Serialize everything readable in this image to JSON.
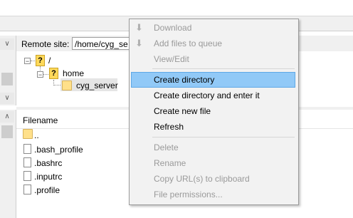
{
  "remote": {
    "label": "Remote site:",
    "path": "/home/cyg_se"
  },
  "tree": {
    "root": "/",
    "home": "home",
    "child": "cyg_server"
  },
  "list": {
    "column_filename": "Filename",
    "files": [
      "..",
      ".bash_profile",
      ".bashrc",
      ".inputrc",
      ".profile"
    ]
  },
  "context_menu": {
    "items": [
      {
        "label": "Download",
        "enabled": false
      },
      {
        "label": "Add files to queue",
        "enabled": false
      },
      {
        "label": "View/Edit",
        "enabled": false
      },
      {
        "label": "Create directory",
        "enabled": true,
        "highlighted": true
      },
      {
        "label": "Create directory and enter it",
        "enabled": true
      },
      {
        "label": "Create new file",
        "enabled": true
      },
      {
        "label": "Refresh",
        "enabled": true
      },
      {
        "label": "Delete",
        "enabled": false
      },
      {
        "label": "Rename",
        "enabled": false
      },
      {
        "label": "Copy URL(s) to clipboard",
        "enabled": false
      },
      {
        "label": "File permissions...",
        "enabled": false
      }
    ]
  },
  "colors": {
    "highlight": "#91c9f7",
    "disabled_text": "#9a9a9a"
  }
}
